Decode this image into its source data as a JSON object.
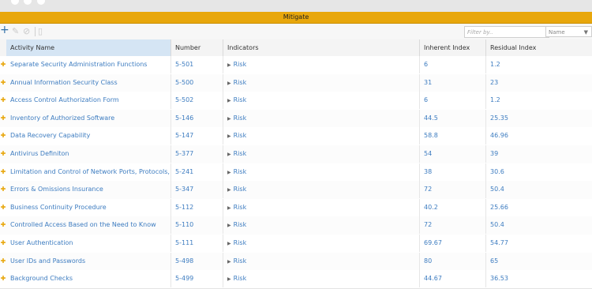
{
  "header": {
    "title": "Mitigate"
  },
  "toolbar": {
    "add_icon": "plus-icon",
    "edit_icon": "pencil-icon",
    "tag_icon": "tag-icon",
    "delete_icon": "trash-icon",
    "filter_placeholder": "Filter by..",
    "filter_field": "Name"
  },
  "columns": [
    "Activity Name",
    "Number",
    "Indicators",
    "Inherent Index",
    "Residual Index"
  ],
  "indicator_label": "Risk",
  "rows": [
    {
      "name": "Separate Security Administration Functions",
      "number": "5-501",
      "inherent": "6",
      "residual": "1.2"
    },
    {
      "name": "Annual Information Security Class",
      "number": "5-500",
      "inherent": "31",
      "residual": "23"
    },
    {
      "name": "Access Control Authorization Form",
      "number": "5-502",
      "inherent": "6",
      "residual": "1.2"
    },
    {
      "name": "Inventory of Authorized Software",
      "number": "5-146",
      "inherent": "44.5",
      "residual": "25.35"
    },
    {
      "name": "Data Recovery Capability",
      "number": "5-147",
      "inherent": "58.8",
      "residual": "46.96"
    },
    {
      "name": "Antivirus Definiton",
      "number": "5-377",
      "inherent": "54",
      "residual": "39"
    },
    {
      "name": "Limitation and Control of Network Ports, Protocols, and Services",
      "number": "5-241",
      "inherent": "38",
      "residual": "30.6"
    },
    {
      "name": "Errors & Omissions Insurance",
      "number": "5-347",
      "inherent": "72",
      "residual": "50.4"
    },
    {
      "name": "Business Continuity Procedure",
      "number": "5-112",
      "inherent": "40.2",
      "residual": "25.66"
    },
    {
      "name": "Controlled Access Based on the Need to Know",
      "number": "5-110",
      "inherent": "72",
      "residual": "50.4"
    },
    {
      "name": "User Authentication",
      "number": "5-111",
      "inherent": "69.67",
      "residual": "54.77"
    },
    {
      "name": "User IDs and Passwords",
      "number": "5-498",
      "inherent": "80",
      "residual": "65"
    },
    {
      "name": "Background Checks",
      "number": "5-499",
      "inherent": "44.67",
      "residual": "36.53"
    }
  ],
  "colors": {
    "accent": "#e8a70c",
    "link": "#3d7cc0",
    "header_selected": "#d5e5f4"
  }
}
